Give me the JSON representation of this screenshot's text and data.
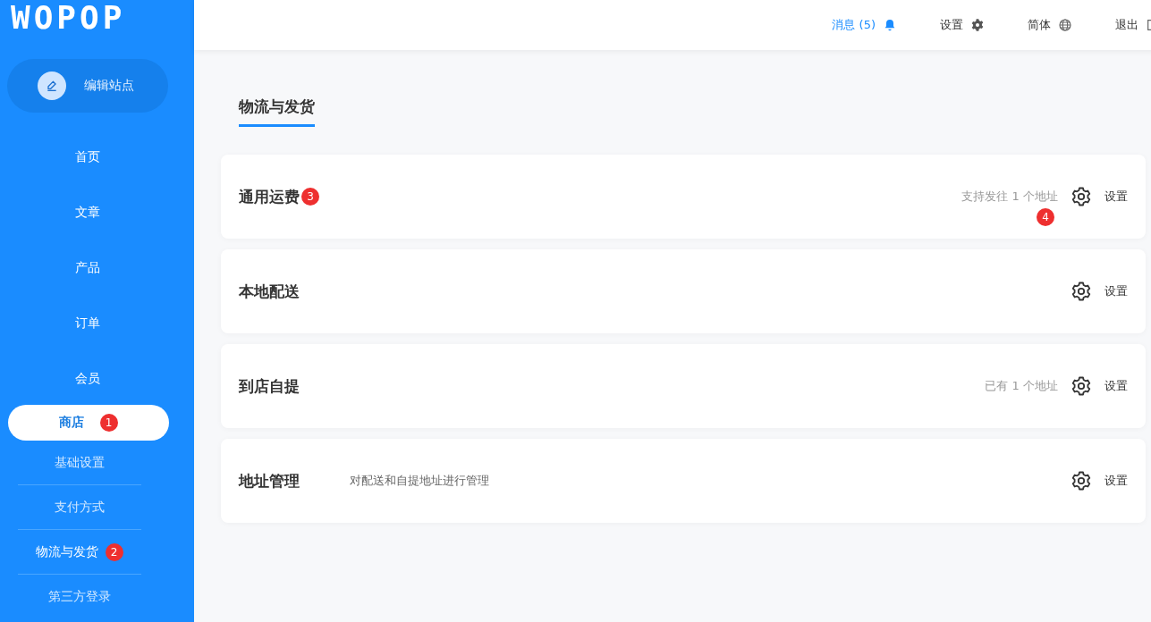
{
  "sidebar": {
    "logo": "WOPOP",
    "edit_button": "编辑站点",
    "nav": [
      {
        "label": "首页",
        "selected": false
      },
      {
        "label": "文章",
        "selected": false
      },
      {
        "label": "产品",
        "selected": false
      },
      {
        "label": "订单",
        "selected": false
      },
      {
        "label": "会员",
        "selected": false
      },
      {
        "label": "商店",
        "selected": true,
        "badge": "1",
        "children": [
          {
            "label": "基础设置",
            "selected": false
          },
          {
            "label": "支付方式",
            "selected": false
          },
          {
            "label": "物流与发货",
            "selected": true,
            "badge": "2"
          },
          {
            "label": "第三方登录",
            "selected": false
          }
        ]
      }
    ]
  },
  "header": [
    {
      "kind": "messages",
      "label": "消息 (5)"
    },
    {
      "kind": "settings",
      "label": "设置"
    },
    {
      "kind": "language",
      "label": "简体"
    },
    {
      "kind": "logout",
      "label": "退出"
    }
  ],
  "tabs": [
    {
      "label": "物流与发货",
      "selected": true
    }
  ],
  "cards": [
    {
      "title": "通用运费",
      "badge": "3",
      "note": "支持发往 1 个地址",
      "note_badge": "4",
      "action": "设置"
    },
    {
      "title": "本地配送",
      "action": "设置"
    },
    {
      "title": "到店自提",
      "note": "已有 1 个地址",
      "action": "设置"
    },
    {
      "title": "地址管理",
      "description": "对配送和自提地址进行管理",
      "action": "设置"
    }
  ]
}
